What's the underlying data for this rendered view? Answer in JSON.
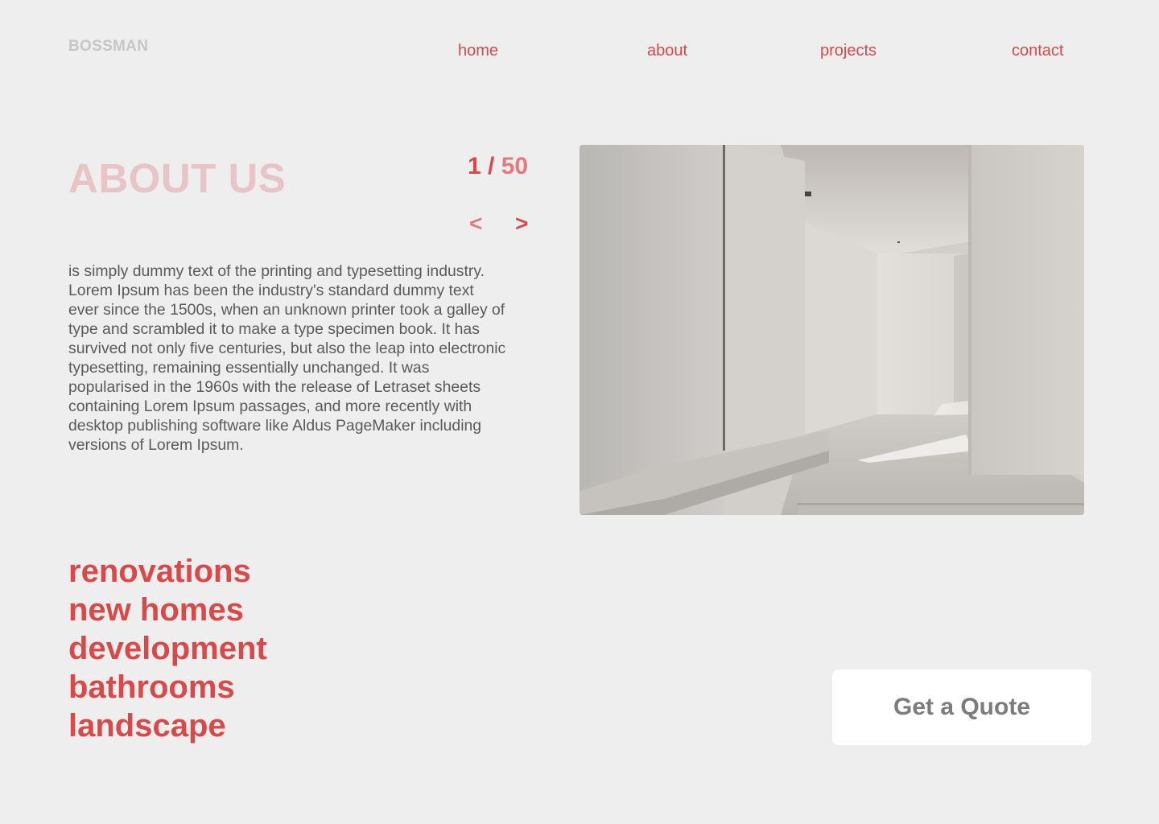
{
  "brand": {
    "name": "BOSSMAN"
  },
  "nav": {
    "items": [
      {
        "label": "home"
      },
      {
        "label": "about"
      },
      {
        "label": "projects"
      },
      {
        "label": "contact"
      }
    ]
  },
  "about": {
    "heading": "ABOUT US",
    "body": "is simply dummy text of the printing and typesetting industry. Lorem Ipsum has been the industry's standard dummy text ever since the 1500s, when an unknown printer took a galley of type and scrambled it to make a type specimen book. It has survived not only five centuries, but also the leap into electronic typesetting, remaining essentially unchanged. It was popularised in the 1960s with the release of Letraset sheets containing Lorem Ipsum passages, and more recently with desktop publishing software like Aldus PageMaker including versions of Lorem Ipsum."
  },
  "slider": {
    "current": "1",
    "separator": " /",
    "total": " 50",
    "prev_label": "<",
    "next_label": ">"
  },
  "services": [
    {
      "label": "renovations"
    },
    {
      "label": "new homes"
    },
    {
      "label": "development"
    },
    {
      "label": "bathrooms"
    },
    {
      "label": "landscape"
    }
  ],
  "cta": {
    "label": "Get a Quote"
  },
  "colors": {
    "accent": "#d84a4a",
    "accent_light": "#e27b7d",
    "heading_faded": "#e9c4c6",
    "background": "#eeeeee",
    "logo": "#c6c6c6",
    "body_text": "#5a5a5a",
    "button_bg": "#ffffff",
    "button_text": "#7c7c7c"
  }
}
